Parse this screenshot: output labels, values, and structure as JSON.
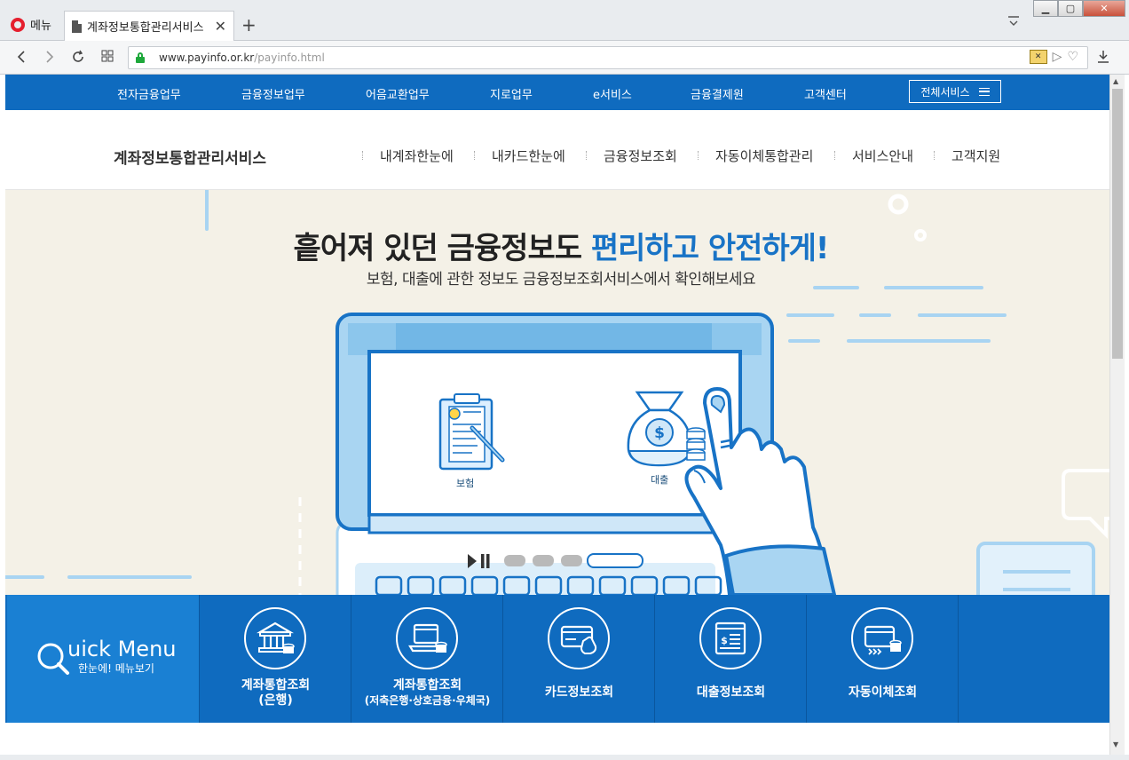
{
  "browser": {
    "menu_label": "메뉴",
    "tab_title": "계좌정보통합관리서비스",
    "url_host": "www.payinfo.or.kr",
    "url_path": "/payinfo.html"
  },
  "topnav": {
    "items": [
      "전자금융업무",
      "금융정보업무",
      "어음교환업무",
      "지로업무",
      "e서비스",
      "금융결제원",
      "고객센터"
    ],
    "all_service": "전체서비스"
  },
  "subheader": {
    "title": "계좌정보통합관리서비스",
    "menu": [
      "내계좌한눈에",
      "내카드한눈에",
      "금융정보조회",
      "자동이체통합관리",
      "서비스안내",
      "고객지원"
    ]
  },
  "hero": {
    "title_plain": "흩어져 있던 금융정보도 ",
    "title_accent": "편리하고 안전하게!",
    "subtitle": "보험, 대출에 관한 정보도 금융정보조회서비스에서 확인해보세요",
    "cards": [
      "보험",
      "대출"
    ]
  },
  "quick_menu": {
    "title": "uick Menu",
    "subtitle": "한눈에! 메뉴보기",
    "items": [
      {
        "line1": "계좌통합조회",
        "line2": "(은행)",
        "icon": "bank-icon"
      },
      {
        "line1": "계좌통합조회",
        "line2": "(저축은행·상호금융·우체국)",
        "icon": "laptop-coins-icon"
      },
      {
        "line1": "카드정보조회",
        "line2": "",
        "icon": "card-icon"
      },
      {
        "line1": "대출정보조회",
        "line2": "",
        "icon": "loan-document-icon"
      },
      {
        "line1": "자동이체조회",
        "line2": "",
        "icon": "auto-transfer-icon"
      }
    ]
  },
  "colors": {
    "primary": "#0f6bbf",
    "quick_head": "#1a80d3",
    "accent_text": "#1873c6",
    "hero_bg": "#f4f1e7"
  }
}
